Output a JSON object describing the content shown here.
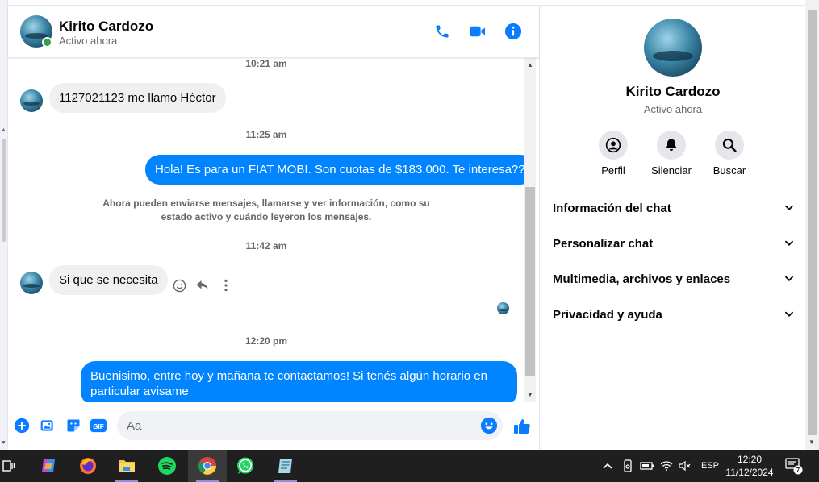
{
  "contact": {
    "name": "Kirito Cardozo",
    "status": "Activo ahora"
  },
  "header_icons": [
    "phone-icon",
    "video-camera-icon",
    "info-icon"
  ],
  "messages": {
    "ts1": "10:21 am",
    "in1": "1127021123 me llamo Héctor",
    "ts2": "11:25 am",
    "out1": "Hola! Es para un FIAT MOBI. Son cuotas de $183.000. Te interesa??",
    "system": "Ahora pueden enviarse mensajes, llamarse y ver información, como su estado activo y cuándo leyeron los mensajes.",
    "ts3": "11:42 am",
    "in2": "Si que se necesita",
    "ts4": "12:20 pm",
    "out2": "Buenisimo, entre hoy y mañana te contactamos! Si tenés algún horario en particular avisame"
  },
  "composer": {
    "placeholder": "Aa",
    "gif_label": "GIF"
  },
  "info_panel": {
    "name": "Kirito Cardozo",
    "status": "Activo ahora",
    "buttons": [
      {
        "label": "Perfil",
        "icon": "profile-icon"
      },
      {
        "label": "Silenciar",
        "icon": "bell-icon"
      },
      {
        "label": "Buscar",
        "icon": "search-icon"
      }
    ],
    "sections": [
      "Información del chat",
      "Personalizar chat",
      "Multimedia, archivos y enlaces",
      "Privacidad y ayuda"
    ]
  },
  "taskbar": {
    "language": "ESP",
    "time": "12:20",
    "date": "11/12/2024",
    "notifications": "7"
  },
  "colors": {
    "accent": "#0084ff",
    "icon_blue": "#0a7cff",
    "online": "#31a24c",
    "taskbar": "#1f1f1f"
  }
}
